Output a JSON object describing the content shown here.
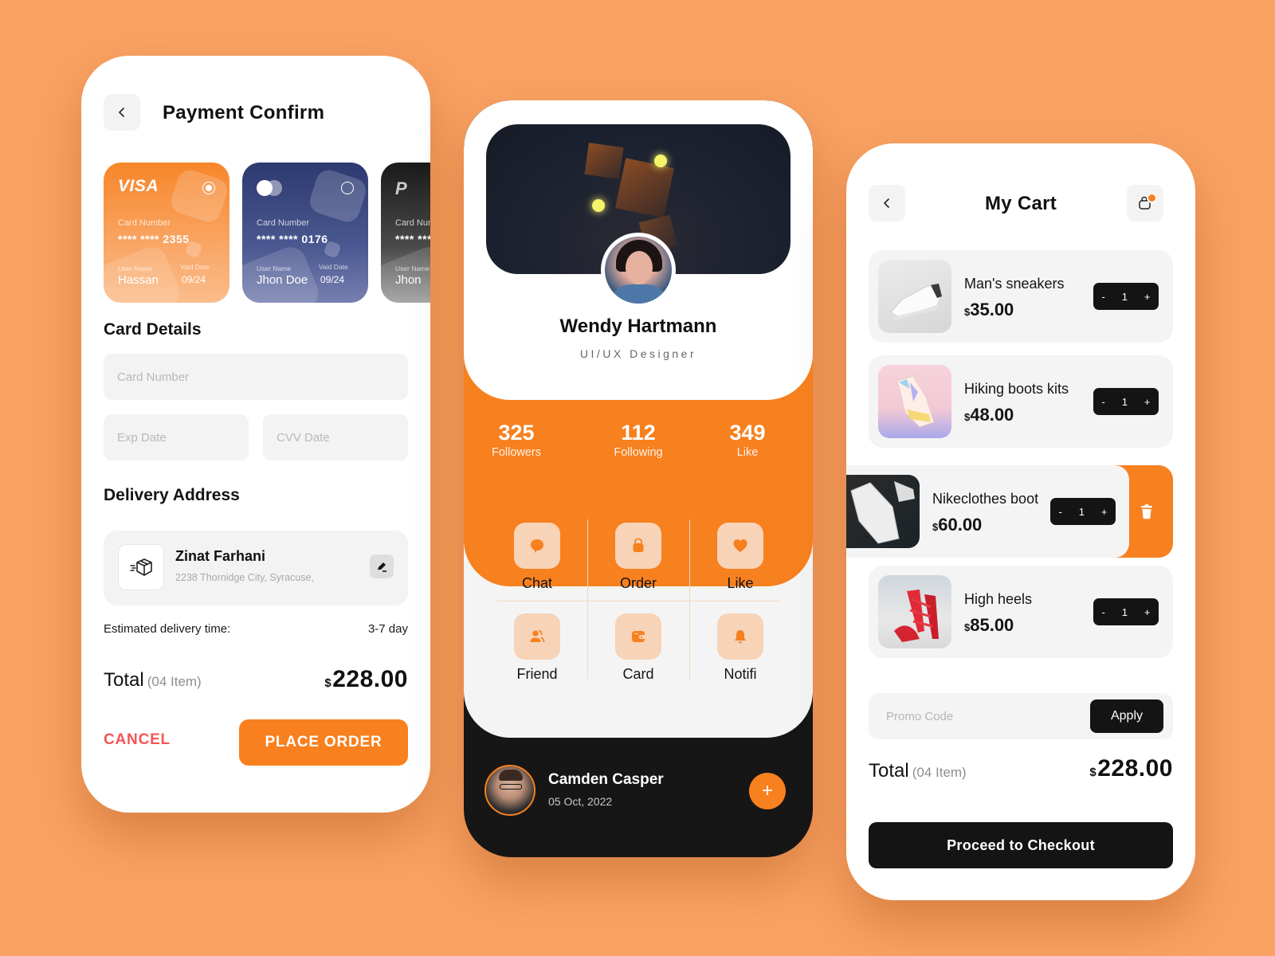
{
  "theme": {
    "background": "#f9a263",
    "accent": "#f7801f",
    "dark": "#141414",
    "danger": "#f35656"
  },
  "payment": {
    "title": "Payment Confirm",
    "back_icon": "chevron-left-icon",
    "cards": [
      {
        "brand": "VISA",
        "label": "Card Number",
        "number": "****  ****  2355",
        "user_label": "User Name",
        "user": "Hassan",
        "valid_label": "Vaid Date",
        "valid": "09/24",
        "selected": true
      },
      {
        "brand": "mastercard",
        "label": "Card Number",
        "number": "****  ****  0176",
        "user_label": "User Name",
        "user": "Jhon Doe",
        "valid_label": "Vaid Date",
        "valid": "09/24",
        "selected": false
      },
      {
        "brand": "P",
        "label": "Card Number",
        "number": "****  ****",
        "user_label": "User Name",
        "user": "Jhon",
        "valid_label": "",
        "valid": "",
        "selected": false
      }
    ],
    "card_details_title": "Card Details",
    "fields": {
      "card_number_placeholder": "Card Number",
      "exp_placeholder": "Exp Date",
      "cvv_placeholder": "CVV Date"
    },
    "delivery_title": "Delivery Address",
    "address": {
      "name": "Zinat Farhani",
      "line": "2238 Thornidge City, Syracuse,",
      "icon": "package-delivery-icon",
      "edit_icon": "edit-pencil-icon"
    },
    "estimate_label": "Estimated  delivery time:",
    "estimate_value": "3-7 day",
    "total_label": "Total",
    "total_items": "(04 Item)",
    "total_currency": "$",
    "total_amount": "228.00",
    "cancel_label": "CANCEL",
    "place_order_label": "PLACE ORDER"
  },
  "profile": {
    "name": "Wendy Hartmann",
    "role": "UI/UX Designer",
    "stats": [
      {
        "value": "325",
        "label": "Followers"
      },
      {
        "value": "112",
        "label": "Following"
      },
      {
        "value": "349",
        "label": "Like"
      }
    ],
    "menu": [
      {
        "label": "Chat",
        "icon": "chat-bubble-icon"
      },
      {
        "label": "Order",
        "icon": "shopping-bag-icon"
      },
      {
        "label": "Like",
        "icon": "heart-icon"
      },
      {
        "label": "Friend",
        "icon": "users-icon"
      },
      {
        "label": "Card",
        "icon": "wallet-icon"
      },
      {
        "label": "Notifi",
        "icon": "bell-icon"
      }
    ],
    "contact": {
      "name": "Camden Casper",
      "date": "05 Oct, 2022",
      "add_label": "+"
    }
  },
  "cart": {
    "title": "My Cart",
    "bag_badge_count": "0",
    "items": [
      {
        "name": "Man's sneakers",
        "currency": "$",
        "price": "35.00",
        "qty": "1"
      },
      {
        "name": "Hiking boots kits",
        "currency": "$",
        "price": "48.00",
        "qty": "1"
      },
      {
        "name": "Nikeclothes boot",
        "currency": "$",
        "price": "60.00",
        "qty": "1",
        "swiped": true
      },
      {
        "name": "High heels",
        "currency": "$",
        "price": "85.00",
        "qty": "1"
      }
    ],
    "stepper": {
      "minus": "-",
      "plus": "+"
    },
    "promo_placeholder": "Promo Code",
    "apply_label": "Apply",
    "total_label": "Total",
    "total_items": "(04 Item)",
    "total_currency": "$",
    "total_amount": "228.00",
    "checkout_label": "Proceed to Checkout"
  }
}
